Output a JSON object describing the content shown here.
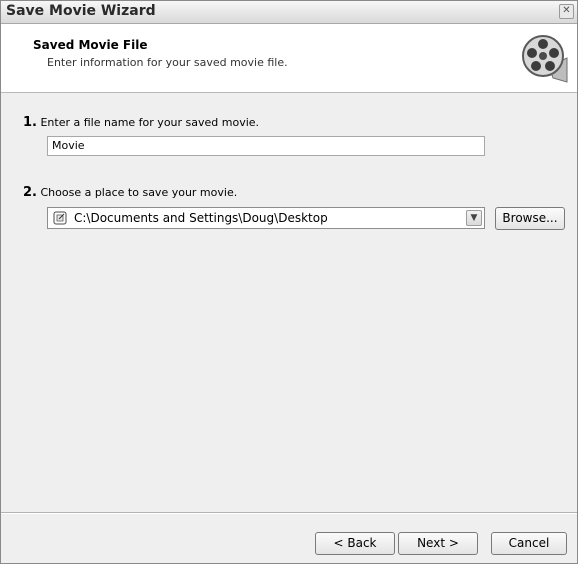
{
  "window": {
    "title": "Save Movie Wizard"
  },
  "header": {
    "title": "Saved Movie File",
    "subtitle": "Enter information for your saved movie file.",
    "icon": "film-reel-icon"
  },
  "step1": {
    "number": "1.",
    "label": "Enter a file name for your saved movie.",
    "value": "Movie"
  },
  "step2": {
    "number": "2.",
    "label": "Choose a place to save your movie.",
    "path": "C:\\Documents and Settings\\Doug\\Desktop",
    "browse_label": "Browse..."
  },
  "footer": {
    "back_label": "< Back",
    "next_label": "Next >",
    "cancel_label": "Cancel"
  }
}
